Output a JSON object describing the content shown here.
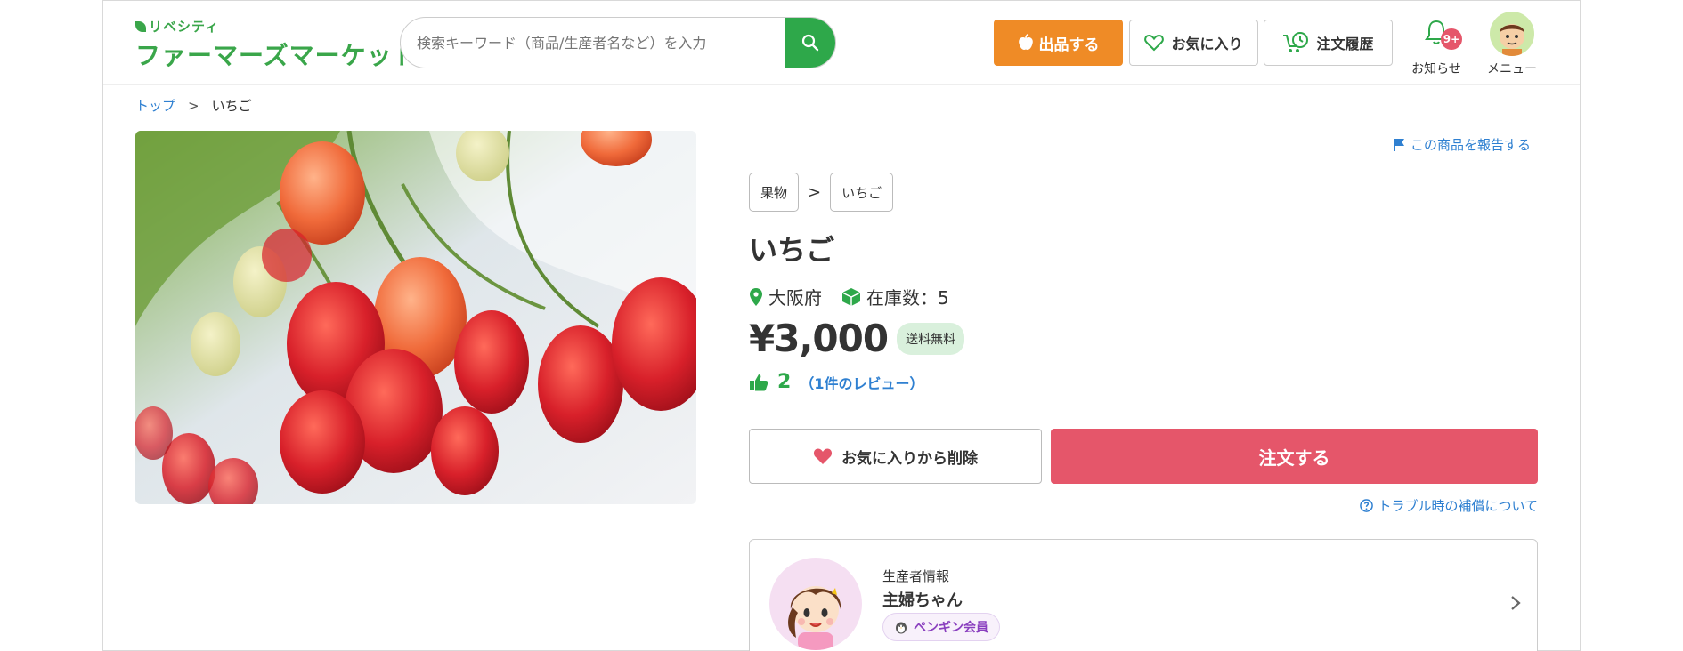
{
  "header": {
    "logo_sub": "リベシティ",
    "logo_main": "ファーマーズマーケット",
    "search_placeholder": "検索キーワード（商品/生産者名など）を入力",
    "sell_label": "出品する",
    "favorites_label": "お気に入り",
    "history_label": "注文履歴",
    "notifications_label": "お知らせ",
    "notifications_badge": "9+",
    "menu_label": "メニュー"
  },
  "breadcrumb": {
    "home": "トップ",
    "separator": ">",
    "current": "いちご"
  },
  "product": {
    "report_label": "この商品を報告する",
    "category": "果物",
    "category_separator": ">",
    "subcategory": "いちご",
    "title": "いちご",
    "location": "大阪府",
    "stock": "在庫数：5",
    "price": "¥3,000",
    "shipping_badge": "送料無料",
    "likes": "2",
    "reviews_link": "（1件のレビュー）",
    "remove_favorite_label": "お気に入りから削除",
    "order_label": "注文する",
    "compensation_link": "トラブル時の補償について"
  },
  "producer": {
    "heading": "生産者情報",
    "name": "主婦ちゃん",
    "member_badge": "ペンギン会員"
  },
  "colors": {
    "brand_green": "#2ea84a",
    "sell_orange": "#ef8b26",
    "order_red": "#e5566a",
    "link_blue": "#2f80d1"
  },
  "icons": {
    "search": "search-icon",
    "sell": "apple-icon",
    "favorites": "heart-outline-icon",
    "history": "cart-clock-icon",
    "notifications": "bell-icon",
    "location": "map-pin-icon",
    "stock": "box-icon",
    "likes": "thumbs-up-icon",
    "report": "flag-icon",
    "compensation": "question-circle-icon"
  }
}
